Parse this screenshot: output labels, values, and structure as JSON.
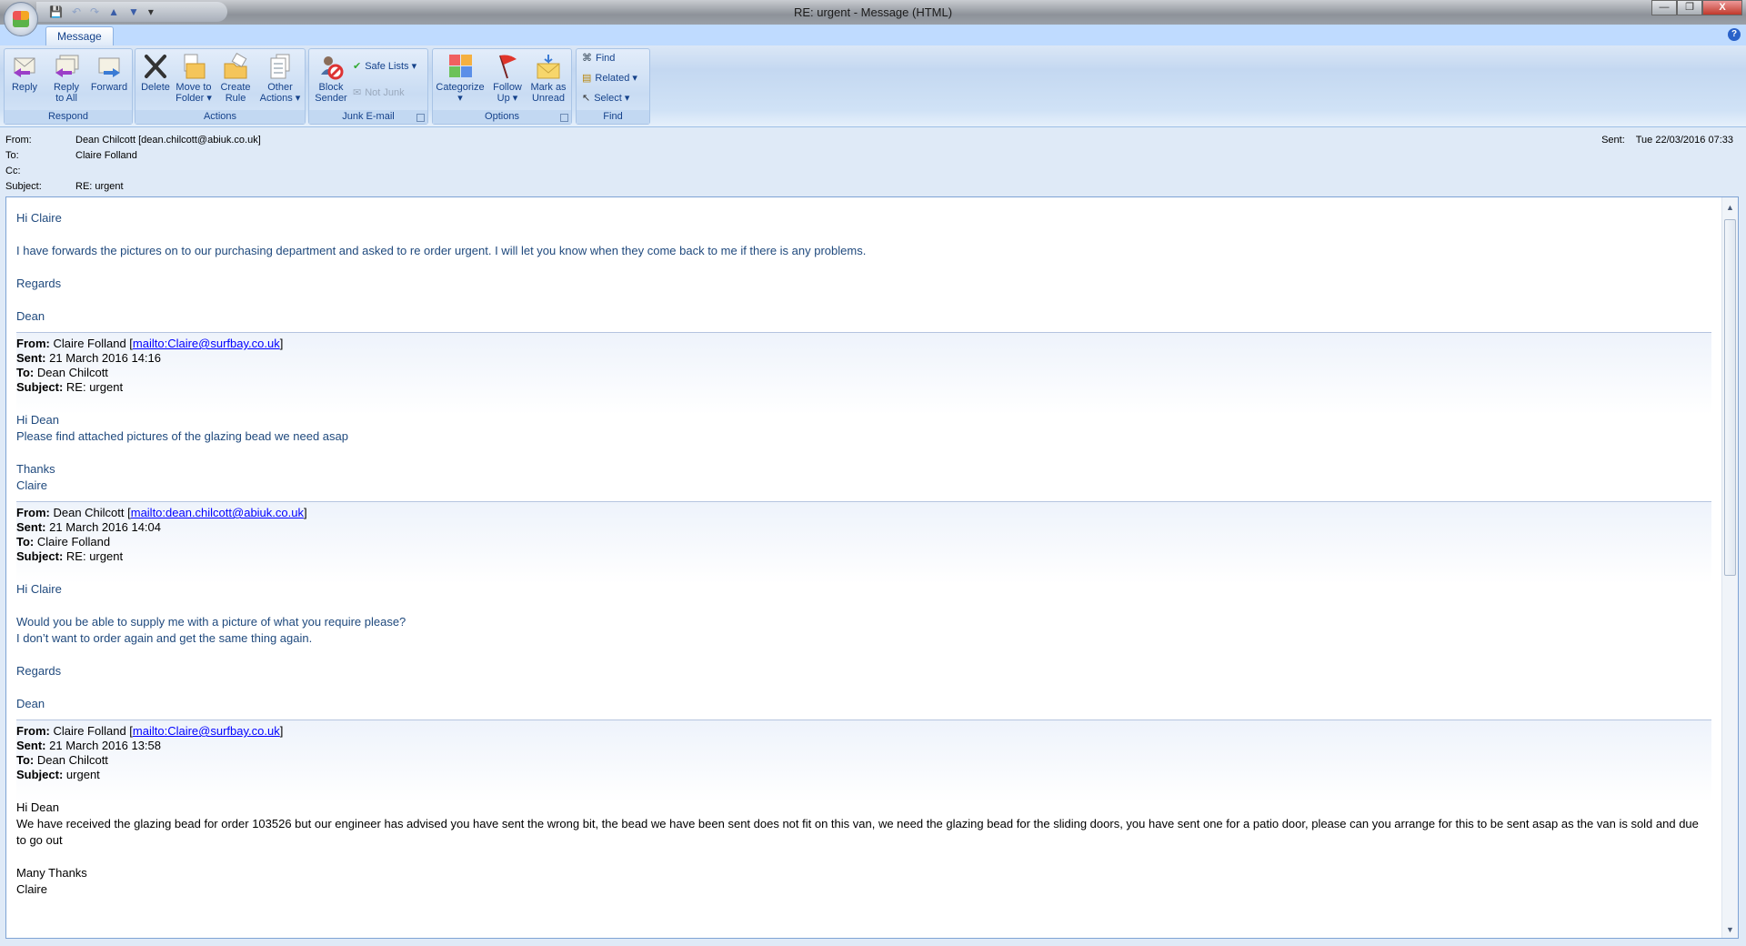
{
  "window": {
    "title": "RE: urgent - Message (HTML)",
    "minimize": "—",
    "restore": "❐",
    "close": "X"
  },
  "qat": {
    "save": "💾",
    "undo": "↶",
    "redo": "↷",
    "up": "▲",
    "down": "▼",
    "customize": "▾"
  },
  "tabs": {
    "message": "Message",
    "help": "?"
  },
  "ribbon": {
    "respond": {
      "label": "Respond",
      "reply": "Reply",
      "reply_all_1": "Reply",
      "reply_all_2": "to All",
      "forward": "Forward"
    },
    "actions": {
      "label": "Actions",
      "delete": "Delete",
      "move_1": "Move to",
      "move_2": "Folder ▾",
      "create_1": "Create",
      "create_2": "Rule",
      "other_1": "Other",
      "other_2": "Actions ▾"
    },
    "junk": {
      "label": "Junk E-mail",
      "block_1": "Block",
      "block_2": "Sender",
      "safe_lists": "Safe Lists ▾",
      "not_junk": "Not Junk"
    },
    "options": {
      "label": "Options",
      "categorize": "Categorize",
      "categorize_2": "▾",
      "follow_1": "Follow",
      "follow_2": "Up ▾",
      "mark_1": "Mark as",
      "mark_2": "Unread"
    },
    "find": {
      "label": "Find",
      "find": "Find",
      "related": "Related ▾",
      "select": "Select ▾"
    }
  },
  "header": {
    "from_label": "From:",
    "from": "Dean Chilcott [dean.chilcott@abiuk.co.uk]",
    "to_label": "To:",
    "to": "Claire Folland",
    "cc_label": "Cc:",
    "cc": "",
    "subject_label": "Subject:",
    "subject": "RE: urgent",
    "sent_label": "Sent:",
    "sent": "Tue 22/03/2016 07:33"
  },
  "body": {
    "greeting": "Hi Claire",
    "para": "I have forwards the pictures on to our purchasing department and asked to re order urgent. I will let you know when they come back to me if there is any problems.",
    "regards": "Regards",
    "sign": "Dean"
  },
  "quotes": [
    {
      "from_label": "From:",
      "from": "Claire Folland [",
      "link": "mailto:Claire@surfbay.co.uk",
      "close": "]",
      "sent_label": "Sent:",
      "sent": "21 March 2016 14:16",
      "to_label": "To:",
      "to": "Dean Chilcott",
      "subject_label": "Subject:",
      "subject": "RE: urgent",
      "lines": [
        "Hi Dean",
        "Please find attached pictures of the glazing bead we need asap",
        "",
        "Thanks",
        "Claire"
      ]
    },
    {
      "from_label": "From:",
      "from": "Dean Chilcott [",
      "link": "mailto:dean.chilcott@abiuk.co.uk",
      "close": "]",
      "sent_label": "Sent:",
      "sent": "21 March 2016 14:04",
      "to_label": "To:",
      "to": "Claire Folland",
      "subject_label": "Subject:",
      "subject": "RE: urgent",
      "lines": [
        "Hi Claire",
        "",
        "Would you be able to supply me with a picture of what you require please?",
        "I don’t want to order again and get the same  thing again.",
        "",
        "Regards",
        "",
        "Dean"
      ]
    },
    {
      "from_label": "From:",
      "from": "Claire Folland [",
      "link": "mailto:Claire@surfbay.co.uk",
      "close": "]",
      "sent_label": "Sent:",
      "sent": "21 March 2016 13:58",
      "to_label": "To:",
      "to": "Dean Chilcott",
      "subject_label": "Subject:",
      "subject": "urgent",
      "lines": [
        "Hi Dean",
        "We have received the glazing bead for order 103526 but our engineer has advised you have sent the wrong bit, the bead we have been sent does not fit on this van, we need the glazing bead for the sliding doors, you have sent one for a patio door, please can you arrange for this to be sent asap as the van is sold and due to go out",
        "",
        "Many Thanks",
        "Claire"
      ]
    }
  ]
}
